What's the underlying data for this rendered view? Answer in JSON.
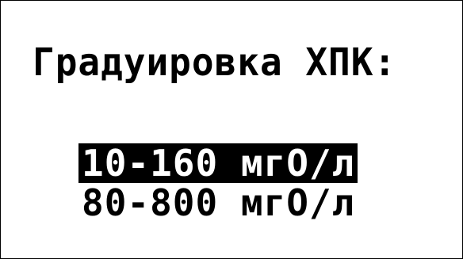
{
  "screen": {
    "title": "Градуировка ХПК:"
  },
  "menu": {
    "items": [
      {
        "label": "10-160 мгО/л",
        "selected": true
      },
      {
        "label": "80-800 мгО/л",
        "selected": false
      }
    ]
  },
  "colors": {
    "background": "#ffffff",
    "foreground": "#000000",
    "selection_background": "#000000",
    "selection_text": "#ffffff"
  }
}
